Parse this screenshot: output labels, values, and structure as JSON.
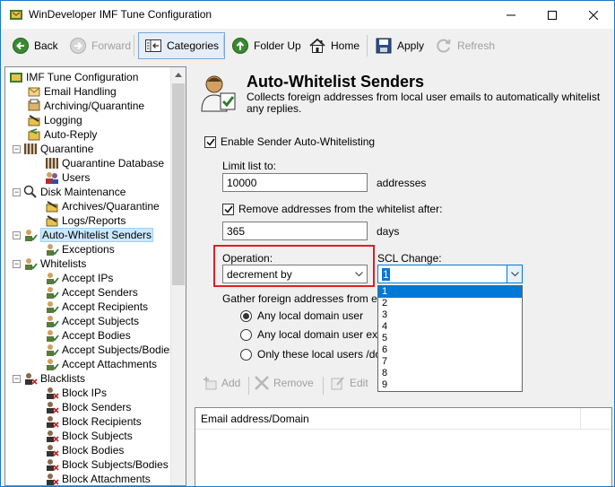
{
  "window": {
    "title": "WinDeveloper IMF Tune Configuration"
  },
  "toolbar": {
    "back": "Back",
    "forward": "Forward",
    "categories": "Categories",
    "folder_up": "Folder Up",
    "home": "Home",
    "apply": "Apply",
    "refresh": "Refresh"
  },
  "tree": [
    {
      "label": "IMF Tune Configuration"
    },
    {
      "label": "Email Handling"
    },
    {
      "label": "Archiving/Quarantine"
    },
    {
      "label": "Logging"
    },
    {
      "label": "Auto-Reply"
    },
    {
      "label": "Quarantine"
    },
    {
      "label": "Quarantine Database"
    },
    {
      "label": "Users"
    },
    {
      "label": "Disk Maintenance"
    },
    {
      "label": "Archives/Quarantine"
    },
    {
      "label": "Logs/Reports"
    },
    {
      "label": "Auto-Whitelist Senders"
    },
    {
      "label": "Exceptions"
    },
    {
      "label": "Whitelists"
    },
    {
      "label": "Accept IPs"
    },
    {
      "label": "Accept Senders"
    },
    {
      "label": "Accept Recipients"
    },
    {
      "label": "Accept Subjects"
    },
    {
      "label": "Accept Bodies"
    },
    {
      "label": "Accept Subjects/Bodies"
    },
    {
      "label": "Accept Attachments"
    },
    {
      "label": "Blacklists"
    },
    {
      "label": "Block IPs"
    },
    {
      "label": "Block Senders"
    },
    {
      "label": "Block Recipients"
    },
    {
      "label": "Block Subjects"
    },
    {
      "label": "Block Bodies"
    },
    {
      "label": "Block Subjects/Bodies"
    },
    {
      "label": "Block Attachments"
    }
  ],
  "header": {
    "title": "Auto-Whitelist Senders",
    "description": "Collects foreign addresses from local user emails to automatically whitelist any replies."
  },
  "form": {
    "enable_label": "Enable Sender Auto-Whitelisting",
    "limit_label": "Limit list to:",
    "limit_value": "10000",
    "limit_unit": "addresses",
    "remove_label": "Remove addresses from the whitelist after:",
    "remove_value": "365",
    "remove_unit": "days",
    "operation_label": "Operation:",
    "operation_value": "decrement by",
    "scl_label": "SCL Change:",
    "scl_value": "1",
    "scl_options": [
      "1",
      "2",
      "3",
      "4",
      "5",
      "6",
      "7",
      "8",
      "9"
    ],
    "gather_label": "Gather foreign addresses from ema",
    "radio_any": "Any local domain user",
    "radio_except": "Any local domain user exce",
    "radio_only": "Only these local users /dom"
  },
  "list": {
    "add": "Add",
    "remove": "Remove",
    "edit": "Edit",
    "column": "Email address/Domain"
  }
}
